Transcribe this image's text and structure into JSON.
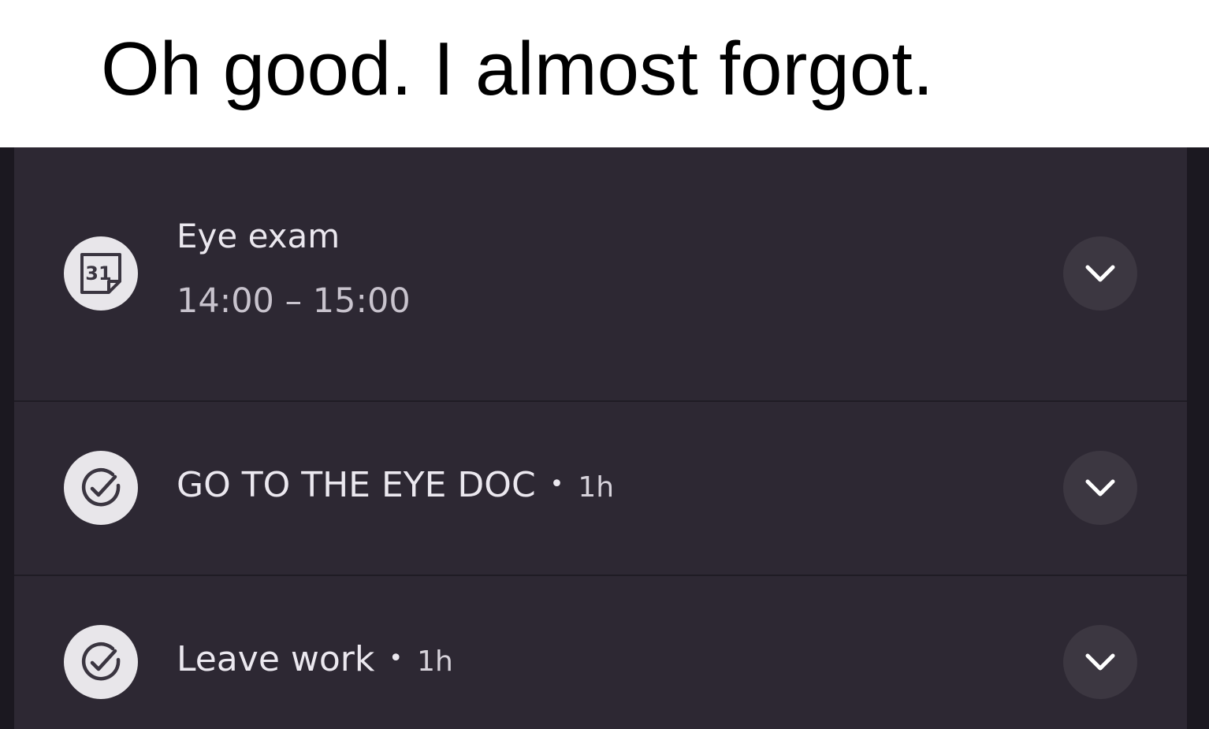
{
  "caption": "Oh good. I almost forgot.",
  "notifications": [
    {
      "app_icon": "calendar-31-icon",
      "calendar_day": "31",
      "title": "Eye exam",
      "subtitle": "14:00 – 15:00",
      "expand_icon": "chevron-down-icon"
    },
    {
      "app_icon": "task-check-icon",
      "title": "GO TO THE EYE DOC",
      "separator": "•",
      "time": "1h",
      "expand_icon": "chevron-down-icon"
    },
    {
      "app_icon": "task-check-icon",
      "title": "Leave work",
      "separator": "•",
      "time": "1h",
      "expand_icon": "chevron-down-icon"
    }
  ],
  "colors": {
    "panel_bg": "#2d2833",
    "screen_bg": "#1b1820",
    "icon_bg": "#e8e6ea",
    "expand_bg": "#3c3741",
    "text_primary": "#ebe8ef",
    "text_secondary": "#c8c3cd"
  }
}
